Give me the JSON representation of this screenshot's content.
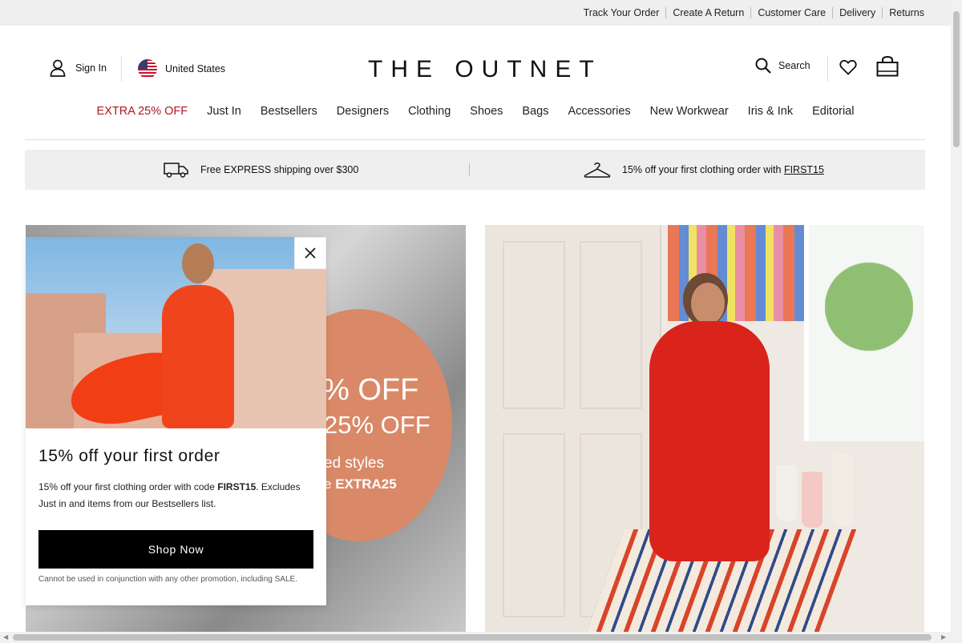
{
  "utility": {
    "links": [
      "Track Your Order",
      "Create A Return",
      "Customer Care",
      "Delivery",
      "Returns"
    ]
  },
  "header": {
    "sign_in": "Sign In",
    "country": "United States",
    "logo": "THE OUTNET",
    "search": "Search"
  },
  "nav": {
    "items": [
      "EXTRA 25% OFF",
      "Just In",
      "Bestsellers",
      "Designers",
      "Clothing",
      "Shoes",
      "Bags",
      "Accessories",
      "New Workwear",
      "Iris & Ink",
      "Editorial"
    ],
    "promo_color": "#b0171f"
  },
  "promo_strip": {
    "shipping": "Free EXPRESS shipping over $300",
    "first_order_prefix": "15% off your first clothing order with ",
    "first_order_code": "FIRST15"
  },
  "hero_left": {
    "line1": "% OFF",
    "line2": " 25% OFF",
    "line3": "ed styles",
    "line4_prefix": "e ",
    "line4_code": "EXTRA25"
  },
  "modal": {
    "title": "15% off your first order",
    "body_prefix": "15% off your first clothing order with code ",
    "body_code": "FIRST15",
    "body_suffix": ". Excludes Just in and items from our Bestsellers list.",
    "cta": "Shop Now",
    "fine_print": "Cannot be used in conjunction with any other promotion, including SALE."
  },
  "colors": {
    "accent": "#b0171f",
    "button": "#000000",
    "strip_bg": "#efefef"
  }
}
